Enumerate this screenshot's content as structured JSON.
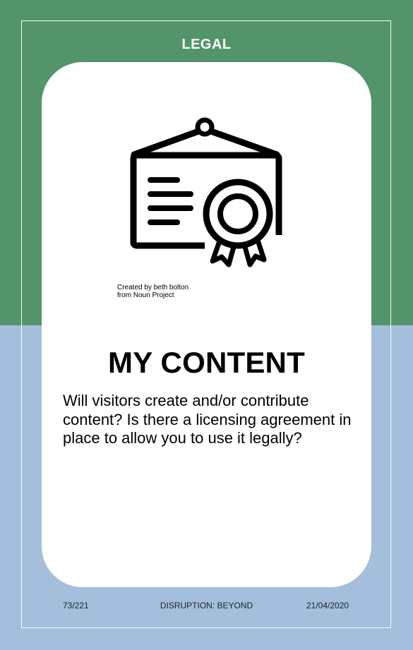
{
  "card": {
    "category": "LEGAL",
    "title": "MY CONTENT",
    "body": "Will visitors create and/or contribute content? Is there a licensing agreement in place to allow you to use it legally?",
    "icon": "certificate-icon",
    "credit": {
      "line1": "Created by beth bolton",
      "line2": "from Noun Project"
    }
  },
  "footer": {
    "page": "73/221",
    "deck": "DISRUPTION: BEYOND",
    "date": "21/04/2020"
  },
  "colors": {
    "top_band": "#53946a",
    "bottom_band": "#a3bfdb",
    "card": "#ffffff"
  }
}
